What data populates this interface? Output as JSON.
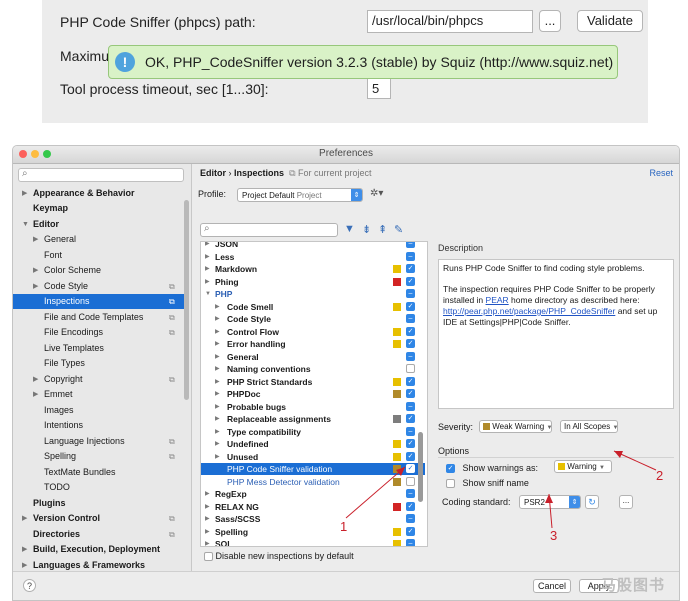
{
  "top_snippet": {
    "path_label": "PHP Code Sniffer (phpcs) path:",
    "path_value": "/usr/local/bin/phpcs",
    "browse_label": "...",
    "validate_label": "Validate",
    "max_label": "Maximu",
    "timeout_label": "Tool process timeout, sec [1...30]:",
    "timeout_value": "5",
    "balloon_message": "OK, PHP_CodeSniffer version 3.2.3 (stable) by Squiz (http://www.squiz.net)"
  },
  "window": {
    "title": "Preferences"
  },
  "sidebar": {
    "search_icon": "search-icon",
    "items": [
      {
        "label": "Appearance & Behavior"
      },
      {
        "label": "Keymap"
      },
      {
        "label": "Editor"
      },
      {
        "label": "General"
      },
      {
        "label": "Font"
      },
      {
        "label": "Color Scheme"
      },
      {
        "label": "Code Style"
      },
      {
        "label": "Inspections"
      },
      {
        "label": "File and Code Templates"
      },
      {
        "label": "File Encodings"
      },
      {
        "label": "Live Templates"
      },
      {
        "label": "File Types"
      },
      {
        "label": "Copyright"
      },
      {
        "label": "Emmet"
      },
      {
        "label": "Images"
      },
      {
        "label": "Intentions"
      },
      {
        "label": "Language Injections"
      },
      {
        "label": "Spelling"
      },
      {
        "label": "TextMate Bundles"
      },
      {
        "label": "TODO"
      },
      {
        "label": "Plugins"
      },
      {
        "label": "Version Control"
      },
      {
        "label": "Directories"
      },
      {
        "label": "Build, Execution, Deployment"
      },
      {
        "label": "Languages & Frameworks"
      }
    ]
  },
  "main": {
    "breadcrumb_root": "Editor",
    "breadcrumb_sep": "›",
    "breadcrumb_page": "Inspections",
    "breadcrumb_scope": "For current project",
    "reset_label": "Reset",
    "profile_label": "Profile:",
    "profile_value": "Project Default",
    "profile_tag": "Project",
    "gear_label": "✲▾"
  },
  "inspections": {
    "rows": [
      {
        "label": "JSON"
      },
      {
        "label": "Less"
      },
      {
        "label": "Markdown"
      },
      {
        "label": "Phing"
      },
      {
        "label": "PHP"
      },
      {
        "label": "Code Smell"
      },
      {
        "label": "Code Style"
      },
      {
        "label": "Control Flow"
      },
      {
        "label": "Error handling"
      },
      {
        "label": "General"
      },
      {
        "label": "Naming conventions"
      },
      {
        "label": "PHP Strict Standards"
      },
      {
        "label": "PHPDoc"
      },
      {
        "label": "Probable bugs"
      },
      {
        "label": "Replaceable assignments"
      },
      {
        "label": "Type compatibility"
      },
      {
        "label": "Undefined"
      },
      {
        "label": "Unused"
      },
      {
        "label": "PHP Code Sniffer validation"
      },
      {
        "label": "PHP Mess Detector validation"
      },
      {
        "label": "RegExp"
      },
      {
        "label": "RELAX NG"
      },
      {
        "label": "Sass/SCSS"
      },
      {
        "label": "Spelling"
      },
      {
        "label": "SQL"
      }
    ],
    "disable_new_label": "Disable new inspections by default"
  },
  "description": {
    "heading": "Description",
    "para1": "Runs PHP Code Sniffer to find coding style problems.",
    "para2_a": "The inspection requires PHP Code Sniffer to be properly installed in ",
    "para2_pear": "PEAR",
    "para2_b": " home directory as described here: ",
    "para2_url": "http://pear.php.net/package/PHP_CodeSniffer",
    "para2_c": " and set up IDE at Settings|PHP|Code Sniffer."
  },
  "severity": {
    "label": "Severity:",
    "value": "Weak Warning",
    "scope": "In All Scopes"
  },
  "options": {
    "heading": "Options",
    "show_warnings_label": "Show warnings as:",
    "warnings_value": "Warning",
    "show_sniff_label": "Show sniff name",
    "coding_standard_label": "Coding standard:",
    "coding_standard_value": "PSR2",
    "browse_label": "..."
  },
  "footer": {
    "help_label": "?",
    "cancel_label": "Cancel",
    "apply_label": "Apply",
    "watermark": "马股图书"
  },
  "annotations": {
    "one": "1",
    "two": "2",
    "three": "3"
  },
  "colors": {
    "selection": "#1b6ed4",
    "annotation_red": "#c9202b",
    "balloon_bg": "#d9f2c7",
    "checkbox_blue": "#2f86e6"
  }
}
